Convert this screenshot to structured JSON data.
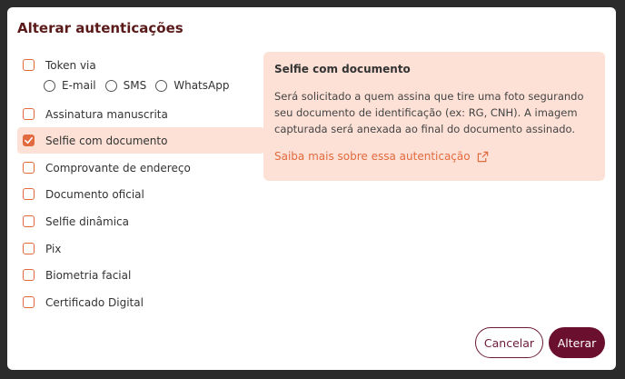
{
  "dialog": {
    "title": "Alterar autenticações",
    "options": [
      {
        "label": "Token via",
        "checked": false
      },
      {
        "label": "Assinatura manuscrita",
        "checked": false
      },
      {
        "label": "Selfie com documento",
        "checked": true
      },
      {
        "label": "Comprovante de endereço",
        "checked": false
      },
      {
        "label": "Documento oficial",
        "checked": false
      },
      {
        "label": "Selfie dinâmica",
        "checked": false
      },
      {
        "label": "Pix",
        "checked": false
      },
      {
        "label": "Biometria facial",
        "checked": false
      },
      {
        "label": "Certificado Digital",
        "checked": false
      }
    ],
    "token_channels": [
      "E-mail",
      "SMS",
      "WhatsApp"
    ],
    "info_panel": {
      "title": "Selfie com documento",
      "text": "Será solicitado a quem assina que tire uma foto segurando seu documento de identificação (ex: RG, CNH). A imagem capturada será anexada ao final do documento assinado.",
      "link": "Saiba mais sobre essa autenticação",
      "link_icon": "external-link-icon"
    },
    "buttons": {
      "cancel": "Cancelar",
      "confirm": "Alterar"
    },
    "colors": {
      "accent": "#e36a3e",
      "primary": "#6b0f2e",
      "highlight": "#fde1d6"
    }
  }
}
